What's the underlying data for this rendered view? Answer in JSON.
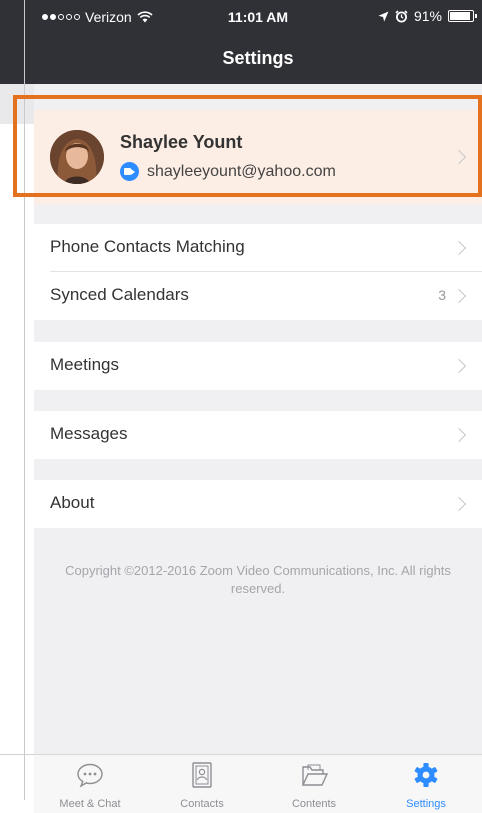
{
  "status_bar": {
    "carrier": "Verizon",
    "time": "11:01 AM",
    "battery": "91%",
    "battery_level": 0.91
  },
  "header": {
    "title": "Settings"
  },
  "profile": {
    "name": "Shaylee Yount",
    "email": "shayleeyount@yahoo.com"
  },
  "settings_groups": {
    "contacts": [
      {
        "label": "Phone Contacts Matching",
        "count": ""
      },
      {
        "label": "Synced Calendars",
        "count": "3"
      }
    ],
    "meetings": {
      "label": "Meetings"
    },
    "messages": {
      "label": "Messages"
    },
    "about": {
      "label": "About"
    }
  },
  "copyright": "Copyright ©2012-2016 Zoom Video Communications, Inc. All rights reserved.",
  "tabs": [
    {
      "label": "Meet & Chat",
      "icon": "chat-bubble-icon"
    },
    {
      "label": "Contacts",
      "icon": "contacts-icon"
    },
    {
      "label": "Contents",
      "icon": "folder-icon"
    },
    {
      "label": "Settings",
      "icon": "gear-icon",
      "active": true
    }
  ],
  "colors": {
    "nav_background": "#2f3137",
    "accent_blue": "#2d8cff",
    "highlight_orange": "#e4711d",
    "selected_row": "#fdeee5"
  }
}
